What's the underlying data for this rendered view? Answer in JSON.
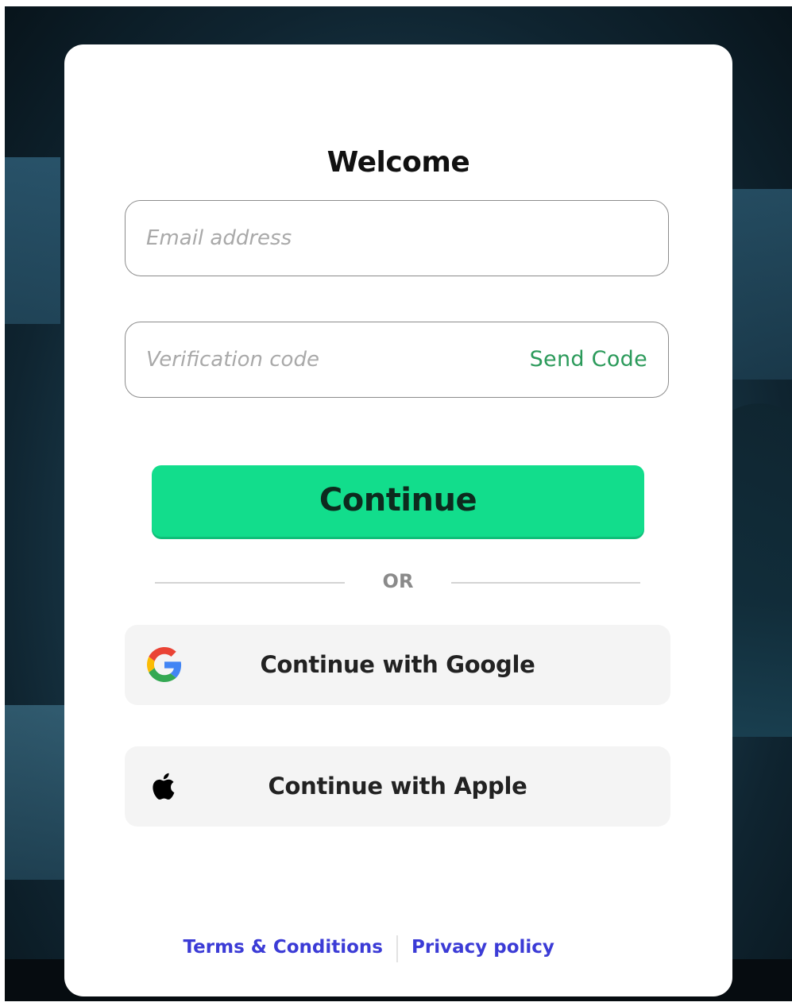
{
  "colors": {
    "accent": "#12dd8c",
    "send_code": "#2b9a5a",
    "link": "#3b3bd6",
    "social_bg": "#f4f4f4"
  },
  "login": {
    "title": "Welcome",
    "email": {
      "placeholder": "Email address",
      "value": ""
    },
    "code": {
      "placeholder": "Verification code",
      "value": "",
      "send_label": "Send Code"
    },
    "continue_label": "Continue",
    "divider_text": "OR",
    "google": {
      "label": "Continue with Google",
      "icon": "google-icon"
    },
    "apple": {
      "label": "Continue with Apple",
      "icon": "apple-icon"
    }
  },
  "footer": {
    "terms": "Terms & Conditions",
    "privacy": "Privacy policy"
  }
}
